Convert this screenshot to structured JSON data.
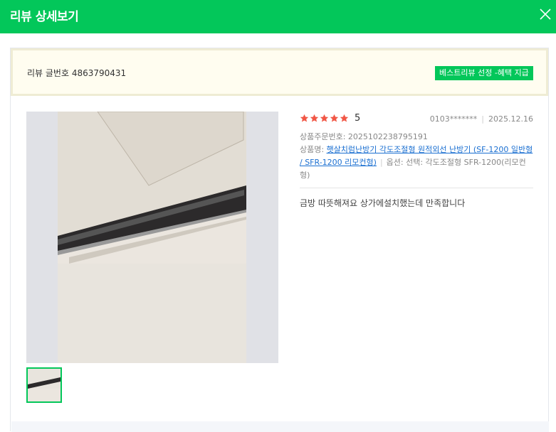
{
  "header": {
    "title": "리뷰 상세보기",
    "close_icon": "close-icon"
  },
  "review": {
    "number_label": "리뷰 글번호 4863790431",
    "best_badge": "베스트리뷰 선정 -혜택 지급",
    "rating": 5,
    "rating_text": "5",
    "author": "0103*******",
    "date": "2025.12.16",
    "order_label": "상품주문번호: 2025102238795191",
    "product_prefix": "상품명: ",
    "product_name": "햇살치럼난방기 각도조절형 원적외선 난방기 (SF-1200 일반형 / SFR-1200 리모컨형)",
    "option_text": "옵션: 선택: 각도조절형 SFR-1200(리모컨형)",
    "content": "금방 따뜻해져요 상가에설치했는데 만족합니다"
  },
  "colors": {
    "brand_green": "#03c75a",
    "star_red": "#f15746",
    "link_blue": "#1a6fd1"
  }
}
